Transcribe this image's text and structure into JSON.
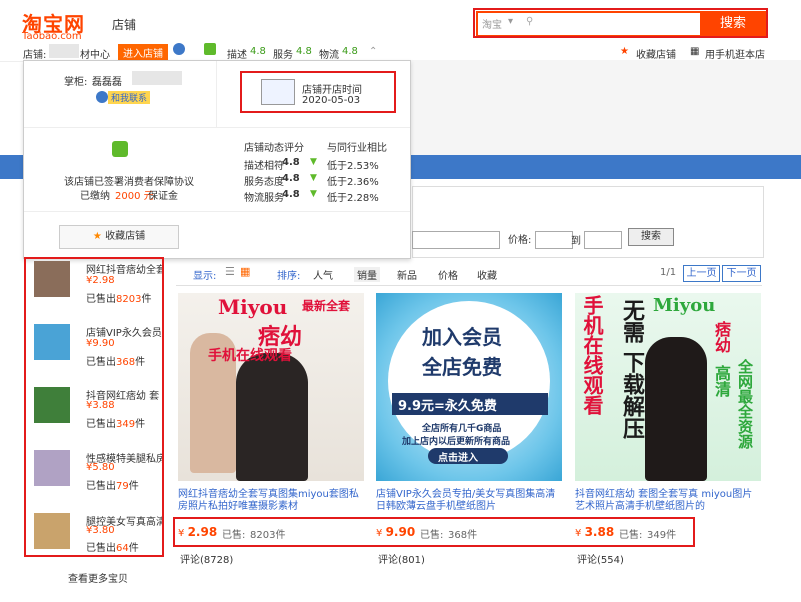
{
  "header": {
    "logo_text": "淘宝网",
    "logo_sub": "Taobao.com",
    "shop_label": "店铺",
    "search_category": "淘宝",
    "search_placeholder": "",
    "search_button": "搜索"
  },
  "shop_bar": {
    "shop_prefix": "店铺:",
    "shop_name_tail": "材中心",
    "enter_shop": "进入店铺",
    "ratings": [
      {
        "label": "描述",
        "value": "4.8"
      },
      {
        "label": "服务",
        "value": "4.8"
      },
      {
        "label": "物流",
        "value": "4.8"
      }
    ],
    "favorite": "收藏店铺",
    "mobile": "用手机逛本店"
  },
  "popup": {
    "owner_label": "掌柜:",
    "owner_name": "磊磊磊",
    "contact": "和我联系",
    "open_time_label": "店铺开店时间",
    "open_time_value": "2020-05-03",
    "protocol_line": "该店铺已签署消费者保障协议",
    "deposit_prefix": "已缴纳",
    "deposit_amount": "2000 元",
    "deposit_suffix": "保证金",
    "score_header": "店铺动态评分",
    "compare_header": "与同行业相比",
    "scores": [
      {
        "label": "描述相符",
        "value": "4.8",
        "compare": "低于2.53%"
      },
      {
        "label": "服务态度",
        "value": "4.8",
        "compare": "低于2.36%"
      },
      {
        "label": "物流服务",
        "value": "4.8",
        "compare": "低于2.28%"
      }
    ],
    "fav_button": "收藏店铺"
  },
  "filter": {
    "price_label": "价格:",
    "to_label": "到",
    "search_button": "搜索"
  },
  "toolbar": {
    "display_label": "显示:",
    "sort_label": "排序:",
    "sorts": [
      "人气",
      "销量",
      "新品",
      "价格",
      "收藏"
    ],
    "page_info": "1/1",
    "prev": "上一页",
    "next": "下一页"
  },
  "sidebar": {
    "items": [
      {
        "name": "网红抖音痞幼全套",
        "price": "¥2.98",
        "sold_prefix": "已售出",
        "sold": "8203",
        "sold_suffix": "件"
      },
      {
        "name": "店铺VIP永久会员",
        "price": "¥9.90",
        "sold_prefix": "已售出",
        "sold": "368",
        "sold_suffix": "件"
      },
      {
        "name": "抖音网红痞幼 套",
        "price": "¥3.88",
        "sold_prefix": "已售出",
        "sold": "349",
        "sold_suffix": "件"
      },
      {
        "name": "性感模特美腿私房",
        "price": "¥5.80",
        "sold_prefix": "已售出",
        "sold": "79",
        "sold_suffix": "件"
      },
      {
        "name": "腿控美女写真高清",
        "price": "¥3.80",
        "sold_prefix": "已售出",
        "sold": "64",
        "sold_suffix": "件"
      }
    ],
    "more": "查看更多宝贝"
  },
  "products": [
    {
      "img_title": "Miyou",
      "img_badge": "最新全套",
      "img_big": "痞幼",
      "img_sub": "手机在线观看",
      "title": "网红抖音痞幼全套写真图集miyou套图私房照片私拍好唯塞摄影素材",
      "currency": "¥",
      "price": "2.98",
      "sold_label": "已售:",
      "sold": "8203件",
      "reviews": "评论(8728)"
    },
    {
      "img_line1": "加入会员",
      "img_line2": "全店免费",
      "img_price": "9.9元=永久免费",
      "img_note1": "全店所有几千G商品",
      "img_note2": "加上店内以后更新所有商品",
      "img_button": "点击进入",
      "title": "店铺VIP永久会员专拍/美女写真图集高清日韩欧薄云盘手机壁纸图片",
      "currency": "¥",
      "price": "9.90",
      "sold_label": "已售:",
      "sold": "368件",
      "reviews": "评论(801)"
    },
    {
      "img_title": "Miyou",
      "img_big": "痞幼",
      "img_left": "手机在线观看",
      "img_mid1": "无需",
      "img_mid2": "下载解压",
      "img_right1": "高清",
      "img_right2": "全网最全资源",
      "title": "抖音网红痞幼 套图全套写真 miyou图片艺术照片高清手机壁纸图片的",
      "currency": "¥",
      "price": "3.88",
      "sold_label": "已售:",
      "sold": "349件",
      "reviews": "评论(554)"
    }
  ],
  "colors": {
    "brand": "#ff4400",
    "highlight_box": "#e31b1b",
    "link": "#3366cc",
    "band": "#3d78c8"
  }
}
